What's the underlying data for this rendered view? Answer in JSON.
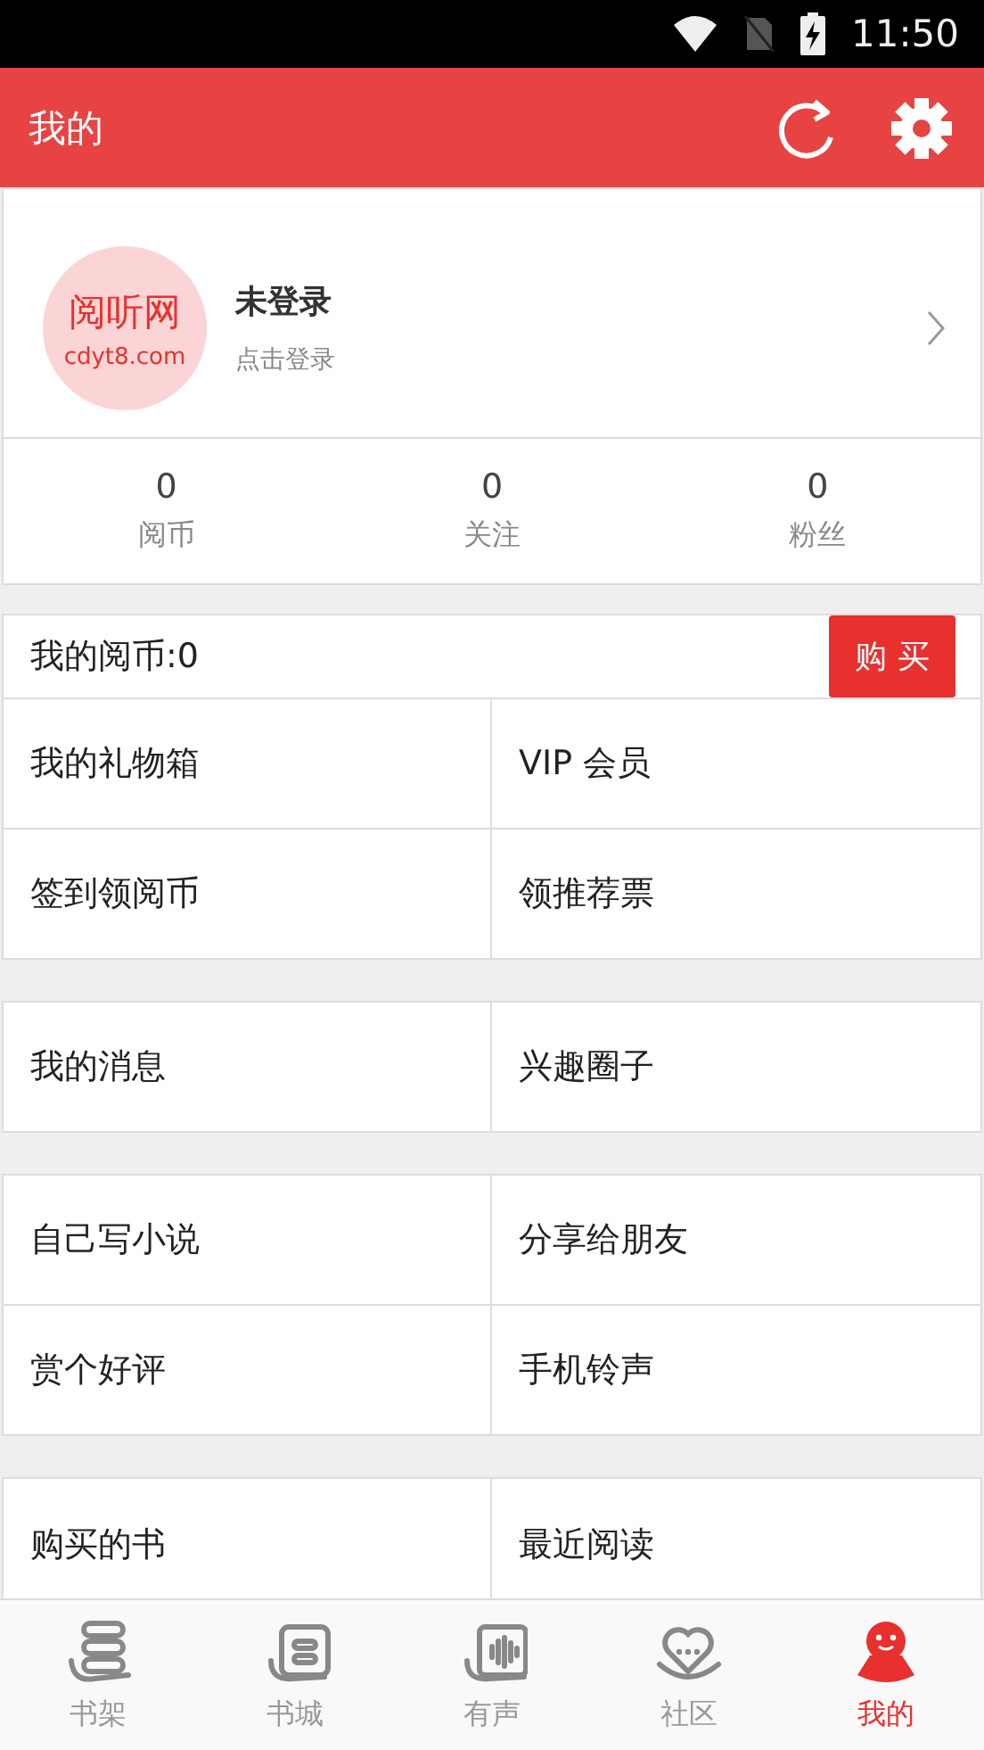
{
  "status_bar": {
    "time": "11:50"
  },
  "app_bar": {
    "title": "我的"
  },
  "profile": {
    "avatar_title": "阅听网",
    "avatar_url": "cdyt8.com",
    "name": "未登录",
    "hint": "点击登录"
  },
  "stats": [
    {
      "value": "0",
      "label": "阅币"
    },
    {
      "value": "0",
      "label": "关注"
    },
    {
      "value": "0",
      "label": "粉丝"
    }
  ],
  "coins": {
    "label": "我的阅币:0",
    "button": "购 买"
  },
  "menu_groups": [
    {
      "items": [
        "我的礼物箱",
        "VIP 会员",
        "签到领阅币",
        "领推荐票"
      ]
    },
    {
      "items": [
        "我的消息",
        "兴趣圈子"
      ]
    },
    {
      "items": [
        "自己写小说",
        "分享给朋友",
        "赏个好评",
        "手机铃声"
      ]
    },
    {
      "items": [
        "购买的书",
        "最近阅读"
      ]
    }
  ],
  "tabs": [
    {
      "label": "书架",
      "kind": "shelf",
      "selected": false
    },
    {
      "label": "书城",
      "kind": "store",
      "selected": false
    },
    {
      "label": "有声",
      "kind": "audio",
      "selected": false
    },
    {
      "label": "社区",
      "kind": "community",
      "selected": false
    },
    {
      "label": "我的",
      "kind": "me",
      "selected": true
    }
  ]
}
